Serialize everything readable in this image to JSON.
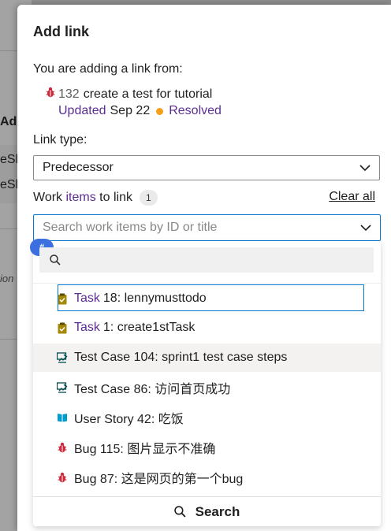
{
  "background": {
    "fragments": [
      "Ad",
      "eSh",
      "eSh",
      "ion"
    ]
  },
  "dialog": {
    "title": "Add link",
    "from_label": "You are adding a link from:",
    "source_item": {
      "id": "132",
      "title": "create a test for tutorial",
      "updated_label": "Updated",
      "updated_date": "Sep 22",
      "state": "Resolved",
      "state_color": "#f6a01a"
    },
    "link_type_label": "Link type:",
    "link_type_value": "Predecessor",
    "work_items_label": {
      "prefix": "Work ",
      "highlight": "items",
      "suffix": " to link"
    },
    "count": "1",
    "clear_all": "Clear all",
    "search_placeholder": "Search work items by ID or title",
    "hash_badge": "#",
    "results": [
      {
        "type": "task",
        "type_kw": "Task",
        "text": "18: lennymusttodo"
      },
      {
        "type": "task",
        "type_kw": "Task",
        "text": "1: create1stTask"
      },
      {
        "type": "testcase",
        "text": "Test Case 104: sprint1 test case steps"
      },
      {
        "type": "testcase",
        "text": "Test Case 86: 访问首页成功"
      },
      {
        "type": "story",
        "text": "User Story 42: 吃饭"
      },
      {
        "type": "bug",
        "text": "Bug 115: 图片显示不准确"
      },
      {
        "type": "bug",
        "text": "Bug 87: 这是网页的第一个bug"
      }
    ],
    "search_button": "Search"
  },
  "colors": {
    "accent": "#0078d4",
    "link_purple": "#5c2e91",
    "bug_red": "#cc293d",
    "task_yellow": "#a4880a",
    "story_blue": "#009ccc",
    "testcase_teal": "#004b50"
  }
}
